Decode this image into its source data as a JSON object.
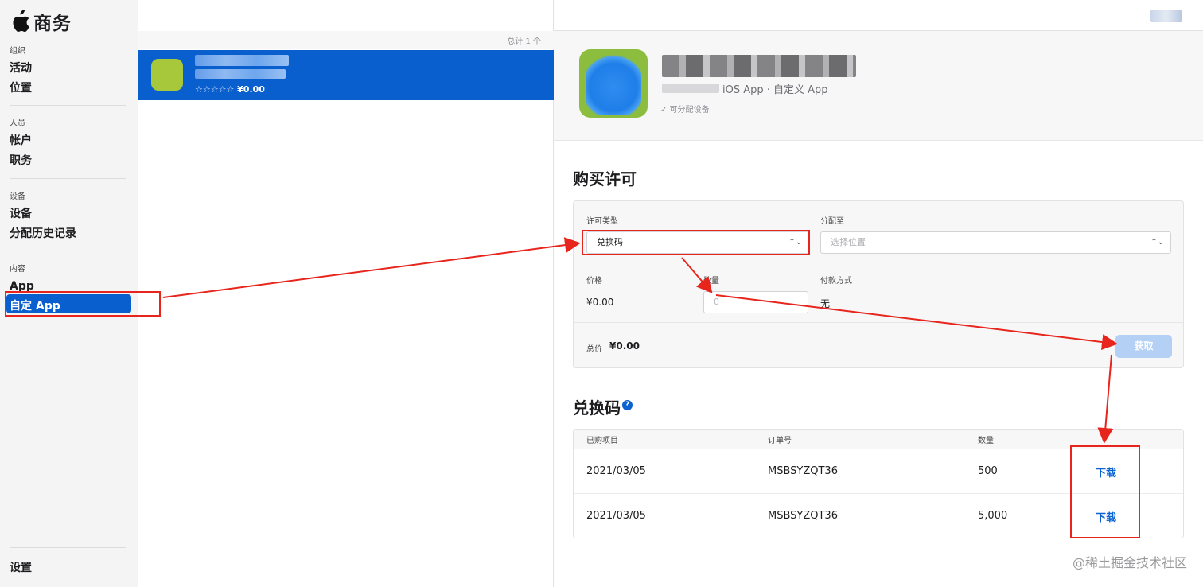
{
  "sidebar": {
    "brand": "商务",
    "sections": [
      {
        "title": "组织",
        "items": [
          "活动",
          "位置"
        ]
      },
      {
        "title": "人员",
        "items": [
          "帐户",
          "职务"
        ]
      },
      {
        "title": "设备",
        "items": [
          "设备",
          "分配历史记录"
        ]
      },
      {
        "title": "内容",
        "items": [
          "App",
          "自定 App"
        ]
      }
    ],
    "settings": "设置",
    "active_item": "自定 App"
  },
  "list": {
    "count_label": "总计 1 个",
    "item_rating_price": "☆☆☆☆☆ ¥0.00"
  },
  "detail": {
    "app_subtitle": "iOS App · 自定义 App",
    "device_note": "✓ 可分配设备",
    "purchase_section_title": "购买许可",
    "license_type_label": "许可类型",
    "license_type_value": "兑换码",
    "assign_label": "分配至",
    "assign_placeholder": "选择位置",
    "price_label": "价格",
    "price_value": "¥0.00",
    "quantity_label": "数量",
    "quantity_placeholder": "0",
    "payment_label": "付款方式",
    "payment_value": "无",
    "total_label": "总价",
    "total_value": "¥0.00",
    "get_button": "获取",
    "codes_section_title": "兑换码",
    "help_icon": "?",
    "table": {
      "headers": [
        "已购项目",
        "订单号",
        "数量"
      ],
      "rows": [
        {
          "date": "2021/03/05",
          "order": "MSBSYZQT36",
          "qty": "500",
          "action": "下载"
        },
        {
          "date": "2021/03/05",
          "order": "MSBSYZQT36",
          "qty": "5,000",
          "action": "下载"
        }
      ]
    }
  },
  "watermark": "@稀土掘金技术社区",
  "colors": {
    "accent": "#0a5fcf",
    "annotation": "#e8251c",
    "app_icon": "#a8c83c"
  }
}
